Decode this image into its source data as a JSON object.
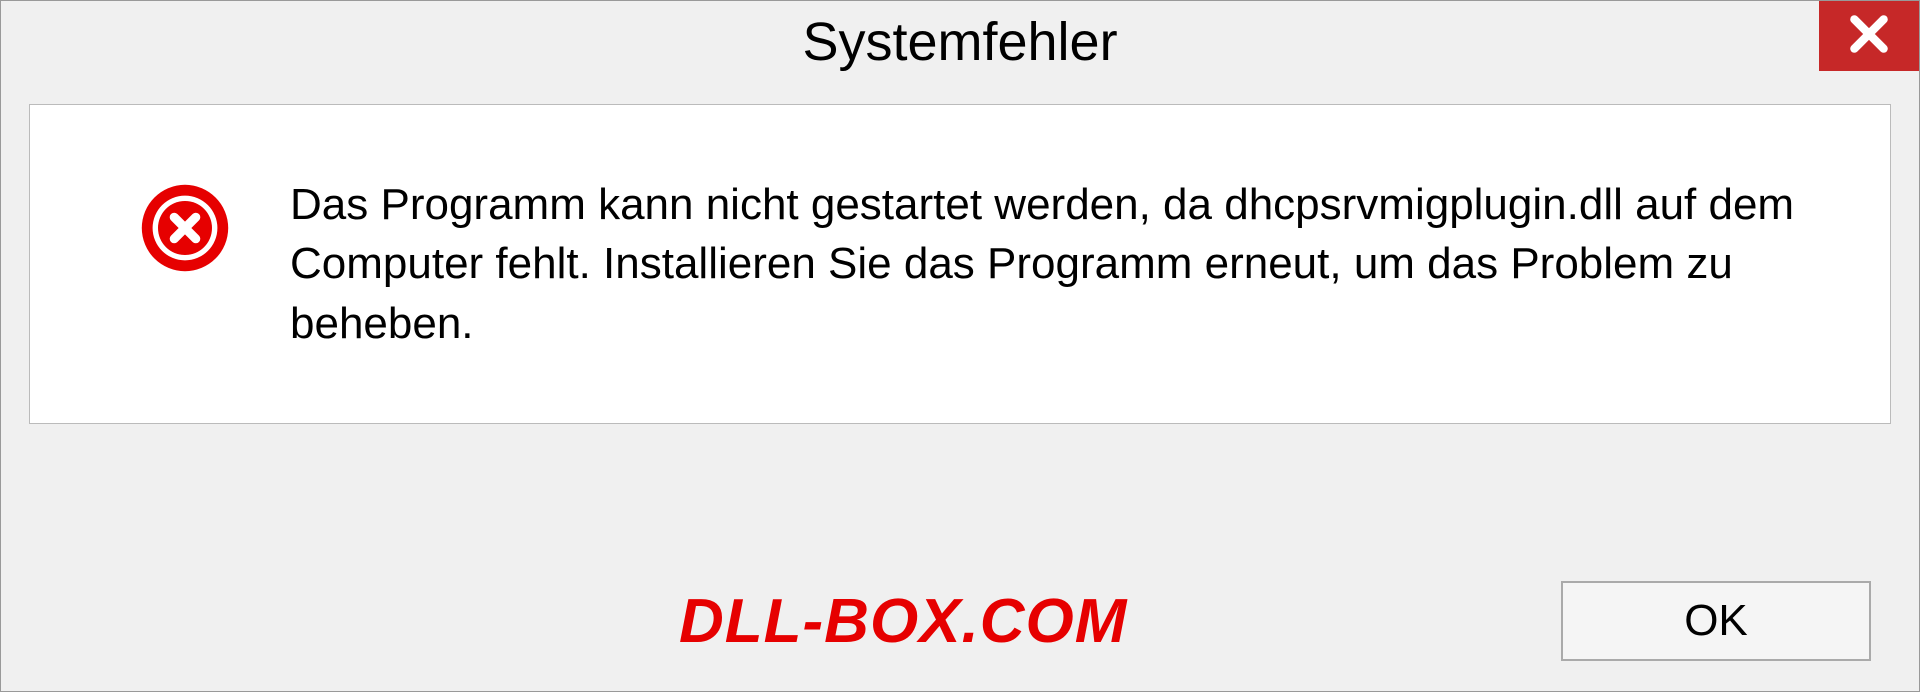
{
  "dialog": {
    "title": "Systemfehler",
    "message": "Das Programm kann nicht gestartet werden, da dhcpsrvmigplugin.dll auf dem Computer fehlt. Installieren Sie das Programm erneut, um das Problem zu beheben.",
    "ok_label": "OK"
  },
  "watermark": "DLL-BOX.COM"
}
